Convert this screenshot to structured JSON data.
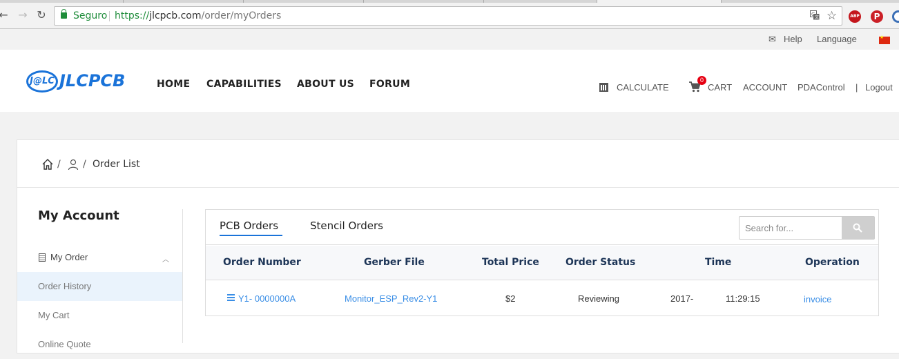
{
  "browser": {
    "security_label": "Seguro",
    "url_protocol": "https://",
    "url_domain": "jlcpcb.com",
    "url_path": "/order/myOrders",
    "extensions": [
      "ABP",
      "pinterest-icon",
      "sync-icon"
    ]
  },
  "topbar": {
    "help": "Help",
    "language": "Language"
  },
  "header": {
    "logo_mark": "J@LC",
    "logo_text": "JLCPCB",
    "nav": [
      "HOME",
      "CAPABILITIES",
      "ABOUT US",
      "FORUM"
    ],
    "calculate": "CALCULATE",
    "cart": "CART",
    "cart_count": "0",
    "account": "ACCOUNT",
    "username": "PDAControl",
    "separator": "|",
    "logout": "Logout"
  },
  "breadcrumb": {
    "separator": "/",
    "current": "Order List"
  },
  "sidebar": {
    "title": "My Account",
    "group": "My Order",
    "items": [
      {
        "label": "Order History",
        "active": true
      },
      {
        "label": "My Cart",
        "active": false
      },
      {
        "label": "Online Quote",
        "active": false
      }
    ]
  },
  "orders": {
    "tabs": [
      "PCB Orders",
      "Stencil Orders"
    ],
    "active_tab": "PCB Orders",
    "search_placeholder": "Search for...",
    "columns": [
      "Order Number",
      "Gerber File",
      "Total Price",
      "Order Status",
      "Time",
      "Operation"
    ],
    "rows": [
      {
        "order_number": "Y1- 0000000A",
        "gerber_file": "Monitor_ESP_Rev2-Y1",
        "total_price": "$2",
        "status": "Reviewing",
        "date": "2017-",
        "time": "11:29:15",
        "operation": "invoice"
      }
    ]
  },
  "colors": {
    "brand": "#1a73d9",
    "link": "#3a8ee6",
    "badge": "#e60012",
    "active_bg": "#eaf3fc"
  }
}
